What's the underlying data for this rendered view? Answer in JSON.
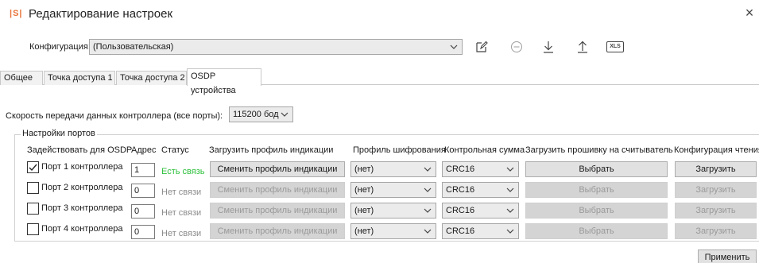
{
  "window": {
    "logo": "|S|",
    "title": "Редактирование настроек",
    "close": "×"
  },
  "config": {
    "label": "Конфигурация:",
    "value": "(Пользовательская)"
  },
  "toolbar": {
    "icons": [
      "edit-icon",
      "remove-icon",
      "download-icon",
      "upload-icon",
      "xls-icon"
    ],
    "xls_text": "XLS"
  },
  "tabs": [
    {
      "label": "Общее",
      "active": false
    },
    {
      "label": "Точка доступа 1",
      "active": false
    },
    {
      "label": "Точка доступа 2",
      "active": false
    },
    {
      "label": "OSDP устройства",
      "active": true
    }
  ],
  "speed": {
    "label": "Скорость передачи данных контроллера (все порты):",
    "value": "115200 бод"
  },
  "ports_group": {
    "title": "Настройки портов",
    "headers": {
      "use": "Задействовать для OSDP",
      "address": "Адрес",
      "status": "Статус",
      "indication": "Загрузить профиль индикации",
      "encryption": "Профиль шифрования",
      "checksum": "Контрольная сумма",
      "firmware": "Загрузить прошивку на считыватель",
      "read_config": "Конфигурация чтения"
    },
    "rows": [
      {
        "checked": true,
        "label": "Порт 1 контроллера",
        "address": "1",
        "status": "Есть связь",
        "connected": true,
        "indication_btn": "Сменить профиль индикации",
        "encryption": "(нет)",
        "checksum": "CRC16",
        "firmware_btn": "Выбрать",
        "read_btn": "Загрузить"
      },
      {
        "checked": false,
        "label": "Порт 2 контроллера",
        "address": "0",
        "status": "Нет связи",
        "connected": false,
        "indication_btn": "Сменить профиль индикации",
        "encryption": "(нет)",
        "checksum": "CRC16",
        "firmware_btn": "Выбрать",
        "read_btn": "Загрузить"
      },
      {
        "checked": false,
        "label": "Порт 3 контроллера",
        "address": "0",
        "status": "Нет связи",
        "connected": false,
        "indication_btn": "Сменить профиль индикации",
        "encryption": "(нет)",
        "checksum": "CRC16",
        "firmware_btn": "Выбрать",
        "read_btn": "Загрузить"
      },
      {
        "checked": false,
        "label": "Порт 4 контроллера",
        "address": "0",
        "status": "Нет связи",
        "connected": false,
        "indication_btn": "Сменить профиль индикации",
        "encryption": "(нет)",
        "checksum": "CRC16",
        "firmware_btn": "Выбрать",
        "read_btn": "Загрузить"
      }
    ]
  },
  "apply": "Применить",
  "colors": {
    "accent": "#e8743b",
    "status_ok": "#2bbf3a",
    "status_bad": "#8a8a8a",
    "icon": "#444444",
    "icon_disabled": "#9e9e9e"
  }
}
